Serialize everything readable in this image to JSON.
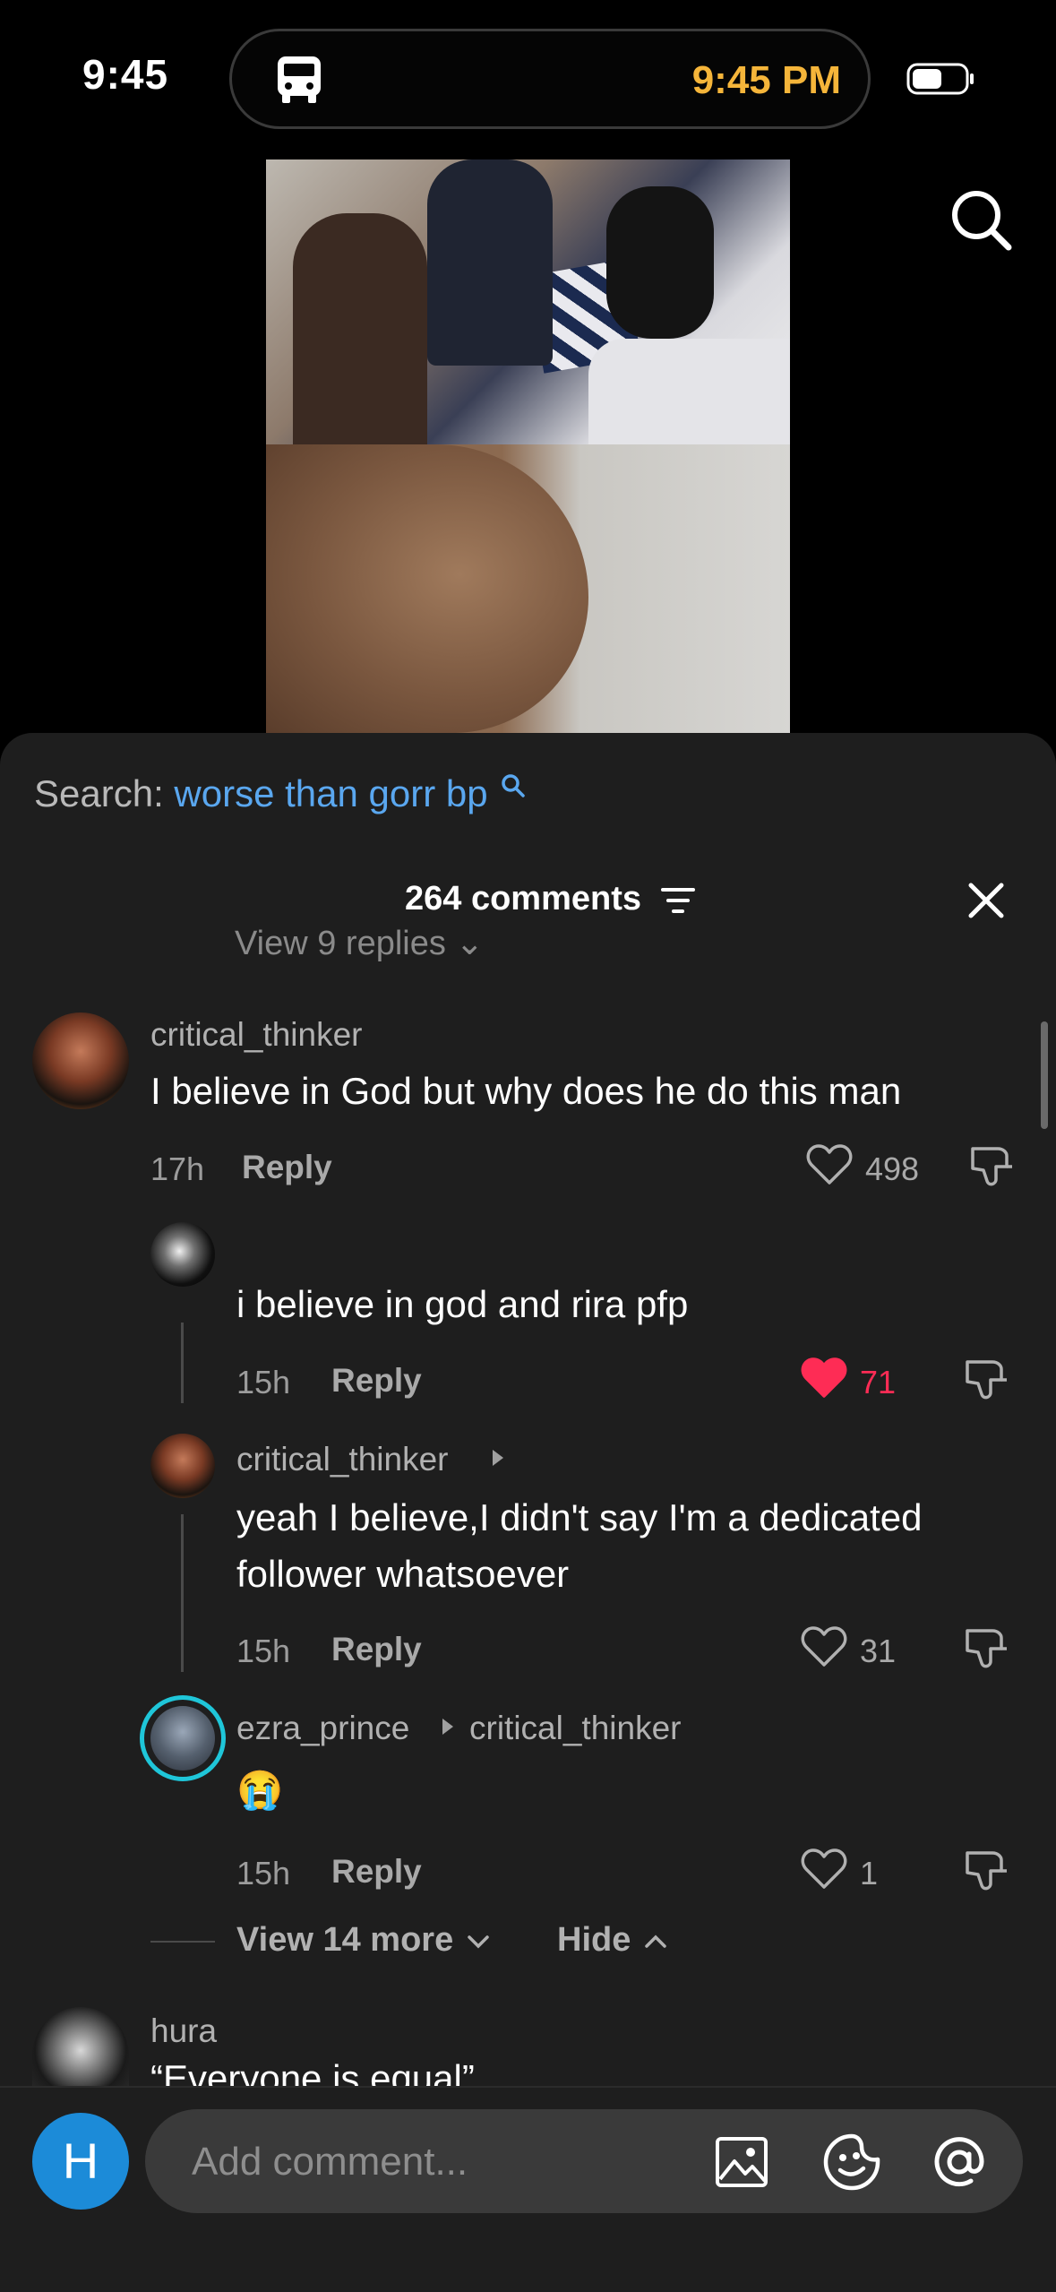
{
  "status_bar": {
    "time": "9:45",
    "island_time": "9:45 PM"
  },
  "search": {
    "label": "Search: ",
    "query": "worse than gorr bp"
  },
  "comments_header": {
    "count": "264 comments"
  },
  "clipped_row": {
    "text": "View 9 replies ⌄"
  },
  "comments": [
    {
      "username": "critical_thinker",
      "text": "I believe in God but why does he do this man",
      "time": "17h",
      "reply_label": "Reply",
      "likes": "498"
    }
  ],
  "replies": [
    {
      "username": "",
      "text": "i believe in god and rira pfp",
      "time": "15h",
      "reply_label": "Reply",
      "likes": "71",
      "liked": true
    },
    {
      "username": "critical_thinker",
      "text_line1": "yeah I believe,I didn't say I'm a dedicated",
      "text_line2": "follower whatsoever",
      "time": "15h",
      "reply_label": "Reply",
      "likes": "31"
    },
    {
      "username": "ezra_prince",
      "reply_to": "critical_thinker",
      "text": "😭",
      "time": "15h",
      "reply_label": "Reply",
      "likes": "1"
    }
  ],
  "thread_controls": {
    "view_more": "View 14 more",
    "hide": "Hide"
  },
  "next_comment": {
    "username": "hura",
    "text": "“Everyone is equal”"
  },
  "composer": {
    "avatar_letter": "H",
    "placeholder": "Add comment..."
  },
  "colors": {
    "accent_blue": "#5aa7ef",
    "like_red": "#fe2c55",
    "island_time": "#f5b53a"
  },
  "icons": [
    "bus-icon",
    "battery-icon",
    "search-icon",
    "filter-icon",
    "close-icon",
    "heart-icon",
    "dislike-icon",
    "image-icon",
    "emoji-icon",
    "mention-icon"
  ]
}
